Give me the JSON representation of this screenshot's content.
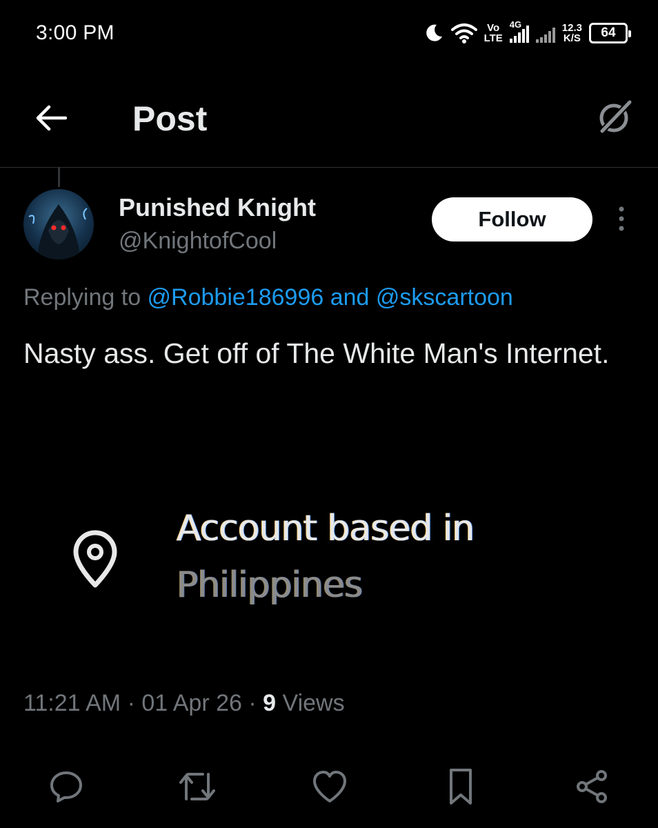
{
  "status_bar": {
    "time": "3:00 PM",
    "volte_top": "Vo",
    "volte_bottom": "LTE",
    "network": "4G",
    "speed_value": "12.3",
    "speed_unit": "K/S",
    "battery": "64"
  },
  "header": {
    "title": "Post"
  },
  "post": {
    "author": {
      "display_name": "Punished Knight",
      "handle": "@KnightofCool"
    },
    "follow_label": "Follow",
    "replying_prefix": "Replying to ",
    "replying_to_1": "@Robbie186996",
    "replying_joiner": " and ",
    "replying_to_2": "@skscartoon",
    "text": "Nasty ass. Get off of The White Man's Internet.",
    "location_card": {
      "label": "Account based in",
      "value": "Philippines"
    },
    "meta": {
      "time": "11:21 AM",
      "separator": " · ",
      "date": "01 Apr 26",
      "views_count": "9",
      "views_label": " Views"
    }
  },
  "actions": [
    "reply-icon",
    "repost-icon",
    "like-icon",
    "bookmark-icon",
    "share-icon"
  ],
  "colors": {
    "background": "#000000",
    "text_primary": "#e7e9ea",
    "text_secondary": "#71767b",
    "accent": "#1d9bf0",
    "divider": "#2f3336"
  }
}
